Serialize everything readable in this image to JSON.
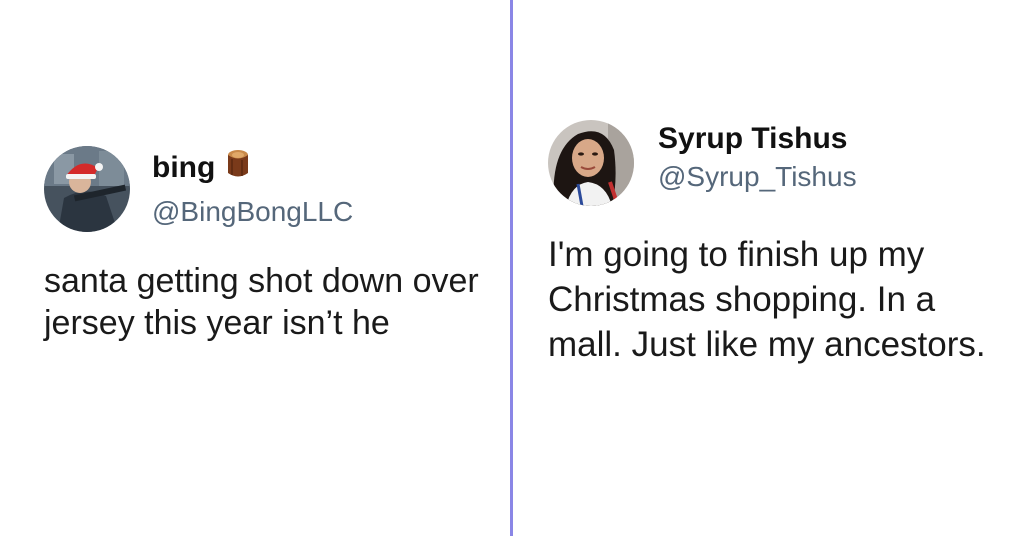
{
  "tweets": [
    {
      "display_name": "bing",
      "emoji_icon": "log-wood-icon",
      "handle": "@BingBongLLC",
      "text": "santa getting shot down over jersey this year isn’t he"
    },
    {
      "display_name": "Syrup Tishus",
      "handle": "@Syrup_Tishus",
      "text": "I'm going to finish up my Christmas shopping. In a mall. Just like my ancestors."
    }
  ],
  "colors": {
    "divider": "#8a86e6",
    "handle": "#55677a",
    "text": "#1a1a1a"
  }
}
